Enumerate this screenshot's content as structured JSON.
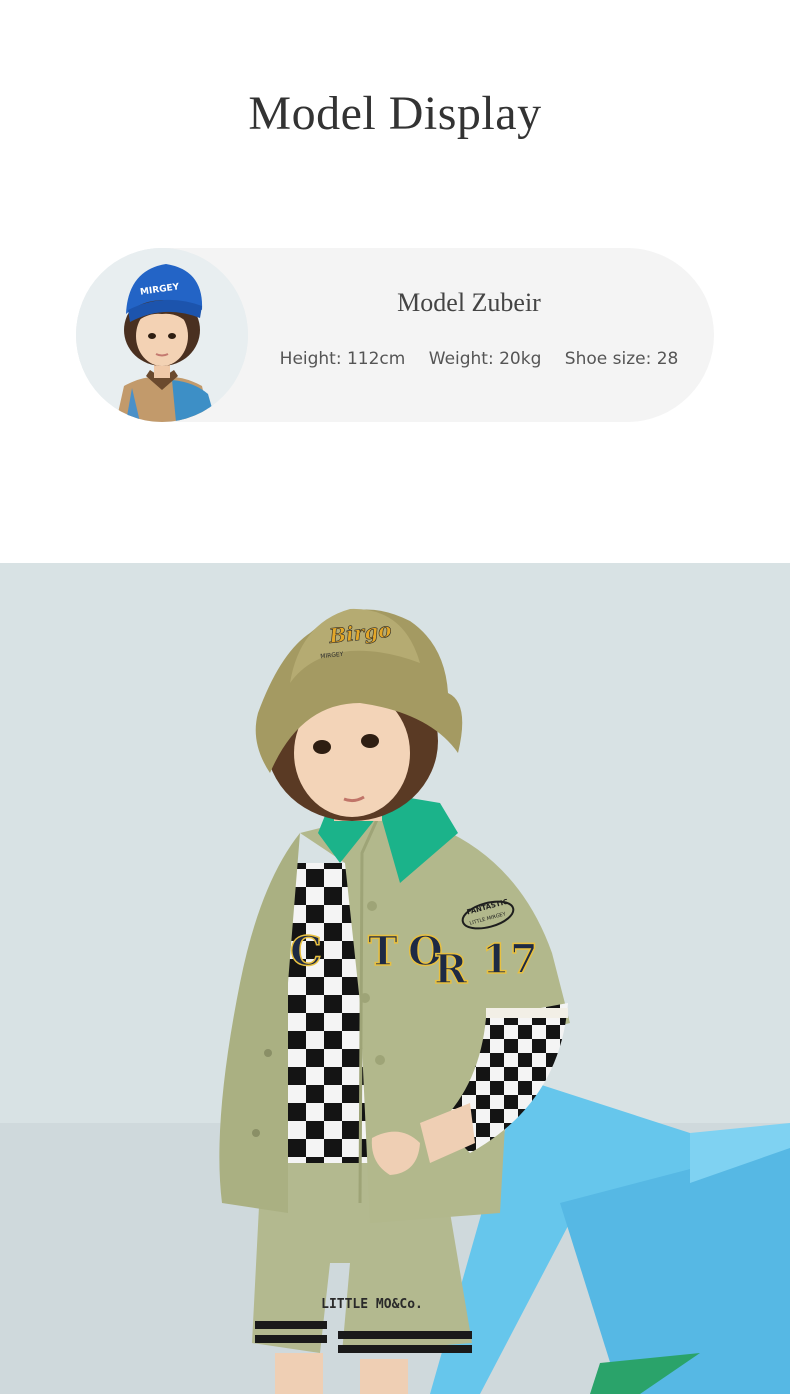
{
  "section": {
    "title": "Model Display"
  },
  "model": {
    "name": "Model Zubeir",
    "height": "Height: 112cm",
    "weight": "Weight: 20kg",
    "shoe_size": "Shoe size: 28",
    "avatar_hat_text": "MIRGEY"
  },
  "photo": {
    "hat_logo": "Birgo",
    "hat_sub": "MIRGEY",
    "jacket_letters": [
      "C",
      "T",
      "O",
      "R"
    ],
    "jacket_number": "17",
    "patch_top": "FANTASTIC",
    "patch_bottom": "LITTLE MIRGEY",
    "shorts_text": "LITTLE MO&Co."
  },
  "colors": {
    "card_bg": "#f4f4f4",
    "photo_bg": "#d8e2e4",
    "outfit_green": "#b2b88c",
    "collar_teal": "#19b48a",
    "prop_blue": "#5fc3ea"
  }
}
